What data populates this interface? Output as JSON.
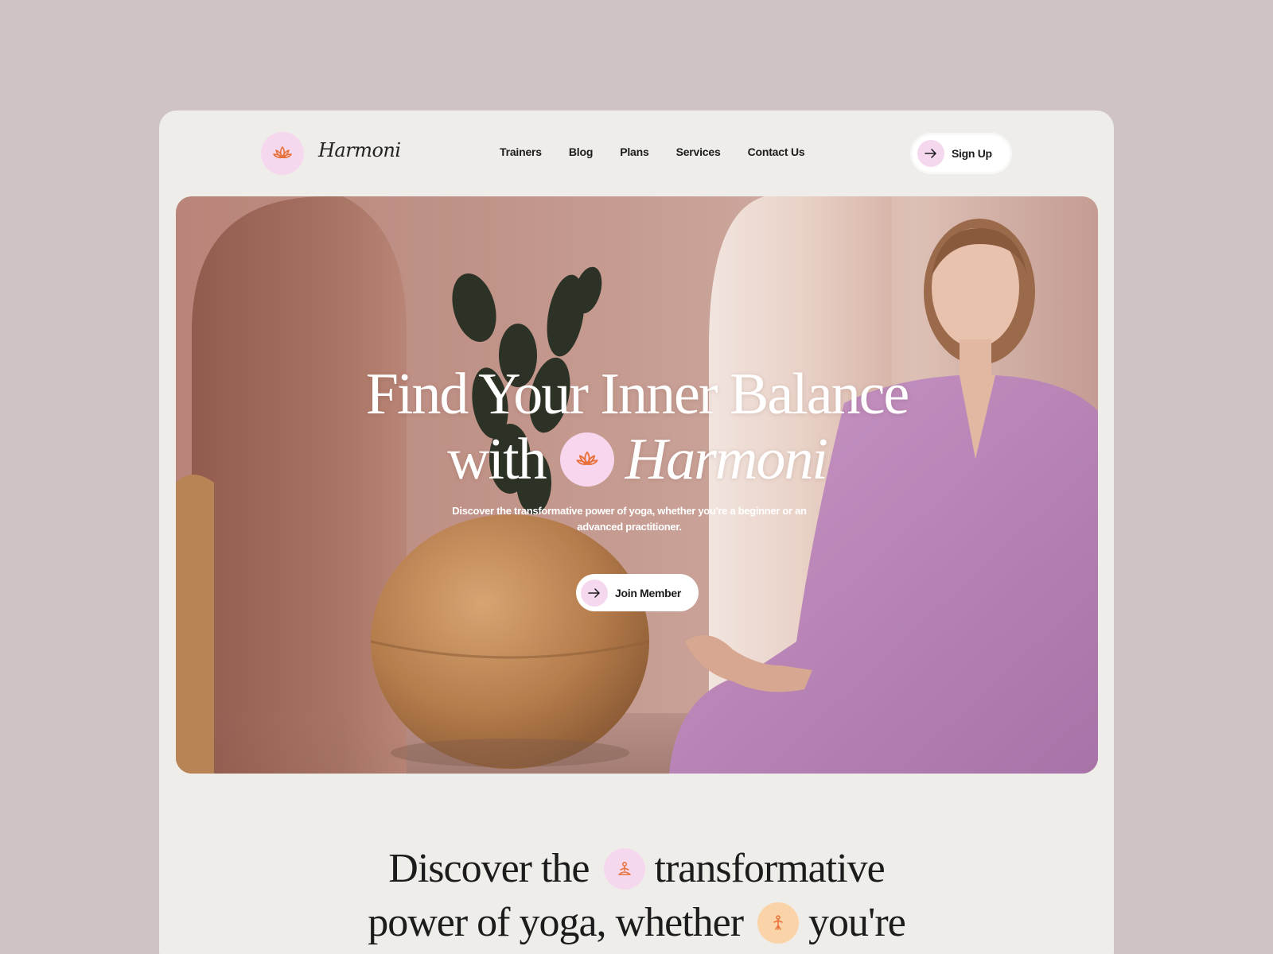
{
  "brand": {
    "name": "Harmoni",
    "logo_icon": "lotus-icon"
  },
  "nav": {
    "links": [
      "Trainers",
      "Blog",
      "Plans",
      "Services",
      "Contact Us"
    ],
    "signup_label": "Sign Up"
  },
  "hero": {
    "title_line1": "Find Your Inner Balance",
    "title_with": "with",
    "title_brand": "Harmoni",
    "subtitle": "Discover the transformative power of yoga, whether you're a beginner or an advanced practitioner.",
    "cta_label": "Join Member"
  },
  "discover": {
    "line1_a": "Discover the",
    "line1_b": "transformative",
    "line2_a": "power of yoga, whether",
    "line2_b": "you're"
  },
  "colors": {
    "page_bg": "#cfc3c3",
    "card_bg": "#eeede9",
    "accent_pink": "#f6d8ee",
    "accent_orange": "#e8713a",
    "accent_peach": "#fbd3a8"
  }
}
